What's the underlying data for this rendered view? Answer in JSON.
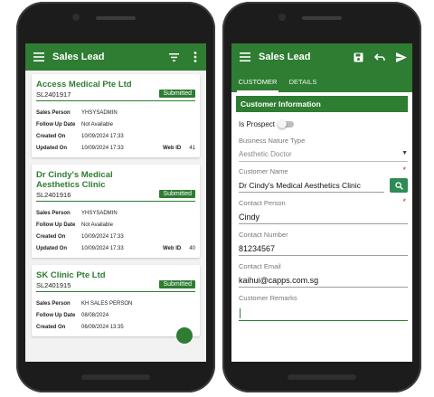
{
  "left": {
    "title": "Sales Lead",
    "cards": [
      {
        "name": "Access Medical Pte Ltd",
        "code": "SL2401917",
        "status": "Submitted",
        "sales_person_label": "Sales Person",
        "sales_person": "YHSYSADMIN",
        "follow_up_label": "Follow Up Date",
        "follow_up": "Not Available",
        "created_label": "Created On",
        "created": "10/09/2024 17:33",
        "updated_label": "Updated On",
        "updated": "10/09/2024 17:33",
        "web_id_label": "Web ID",
        "web_id": "41"
      },
      {
        "name": "Dr Cindy's Medical Aesthetics Clinic",
        "code": "SL2401916",
        "status": "Submitted",
        "sales_person_label": "Sales Person",
        "sales_person": "YHSYSADMIN",
        "follow_up_label": "Follow Up Date",
        "follow_up": "Not Available",
        "created_label": "Created On",
        "created": "10/09/2024 17:33",
        "updated_label": "Updated On",
        "updated": "10/09/2024 17:33",
        "web_id_label": "Web ID",
        "web_id": "40"
      },
      {
        "name": "SK Clinic Pte Ltd",
        "code": "SL2401915",
        "status": "Submitted",
        "sales_person_label": "Sales Person",
        "sales_person": "KH SALES PERSON",
        "follow_up_label": "Follow Up Date",
        "follow_up": "08/08/2024",
        "created_label": "Created On",
        "created": "06/09/2024 13:35"
      }
    ],
    "icons": {
      "menu": "menu-icon",
      "filter": "filter-icon",
      "more": "more-vert-icon",
      "fab": "add-icon"
    },
    "accent": "#2e7d32"
  },
  "right": {
    "title": "Sales Lead",
    "tabs": [
      "CUSTOMER",
      "DETAILS"
    ],
    "section": "Customer Information",
    "is_prospect_label": "Is Prospect",
    "business_nature_label": "Business Nature Type",
    "business_nature_value": "Aesthetic Doctor",
    "customer_name_label": "Customer Name",
    "customer_name_value": "Dr Cindy's Medical Aesthetics Clinic",
    "contact_person_label": "Contact Person",
    "contact_person_value": "Cindy",
    "contact_number_label": "Contact Number",
    "contact_number_value": "81234567",
    "contact_email_label": "Contact Email",
    "contact_email_value": "kaihui@capps.com.sg",
    "remarks_label": "Customer Remarks",
    "required_mark": "*",
    "icons": {
      "menu": "menu-icon",
      "save": "save-icon",
      "undo": "undo-icon",
      "send": "send-icon",
      "search": "search-icon",
      "dropdown": "dropdown-arrow-icon"
    },
    "accent": "#2e7d32"
  }
}
